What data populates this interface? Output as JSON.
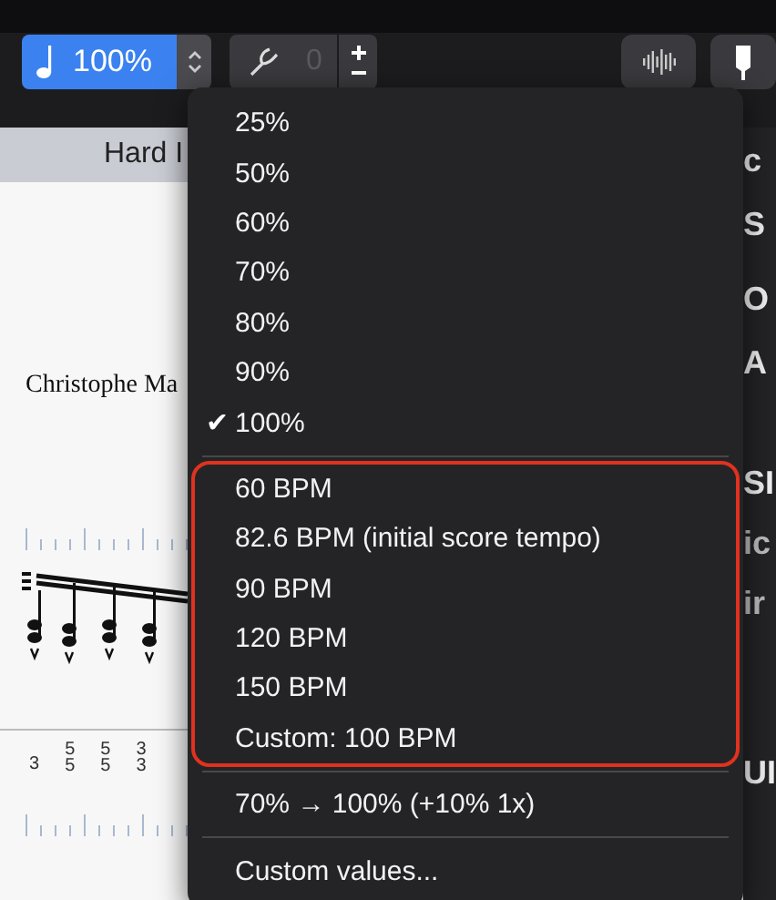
{
  "toolbar": {
    "tempo": {
      "value": "100%"
    },
    "transpose": {
      "value": "0"
    }
  },
  "track_tab": {
    "label": "Hard I"
  },
  "score": {
    "composer": "Christophe Ma",
    "tab_columns": [
      [
        "3"
      ],
      [
        "5",
        "5"
      ],
      [
        "5",
        "5"
      ],
      [
        "3",
        "3"
      ]
    ]
  },
  "side_panel": {
    "fragments": [
      "c",
      "S",
      "O",
      "A",
      "SI",
      "ic",
      "ir",
      "UI"
    ]
  },
  "tempo_menu": {
    "sections": [
      {
        "highlighted": false,
        "items": [
          {
            "label": "25%",
            "selected": false
          },
          {
            "label": "50%",
            "selected": false
          },
          {
            "label": "60%",
            "selected": false
          },
          {
            "label": "70%",
            "selected": false
          },
          {
            "label": "80%",
            "selected": false
          },
          {
            "label": "90%",
            "selected": false
          },
          {
            "label": "100%",
            "selected": true
          }
        ]
      },
      {
        "highlighted": true,
        "items": [
          {
            "label": "60 BPM",
            "selected": false
          },
          {
            "label": "82.6 BPM (initial score tempo)",
            "selected": false
          },
          {
            "label": "90 BPM",
            "selected": false
          },
          {
            "label": "120 BPM",
            "selected": false
          },
          {
            "label": "150 BPM",
            "selected": false
          },
          {
            "label": "Custom: 100 BPM",
            "selected": false
          }
        ]
      },
      {
        "highlighted": false,
        "items": [
          {
            "label": "70% → 100% (+10% 1x)",
            "selected": false
          }
        ]
      },
      {
        "highlighted": false,
        "items": [
          {
            "label": "Custom values...",
            "selected": false
          }
        ]
      }
    ],
    "check_mark": "✔"
  }
}
